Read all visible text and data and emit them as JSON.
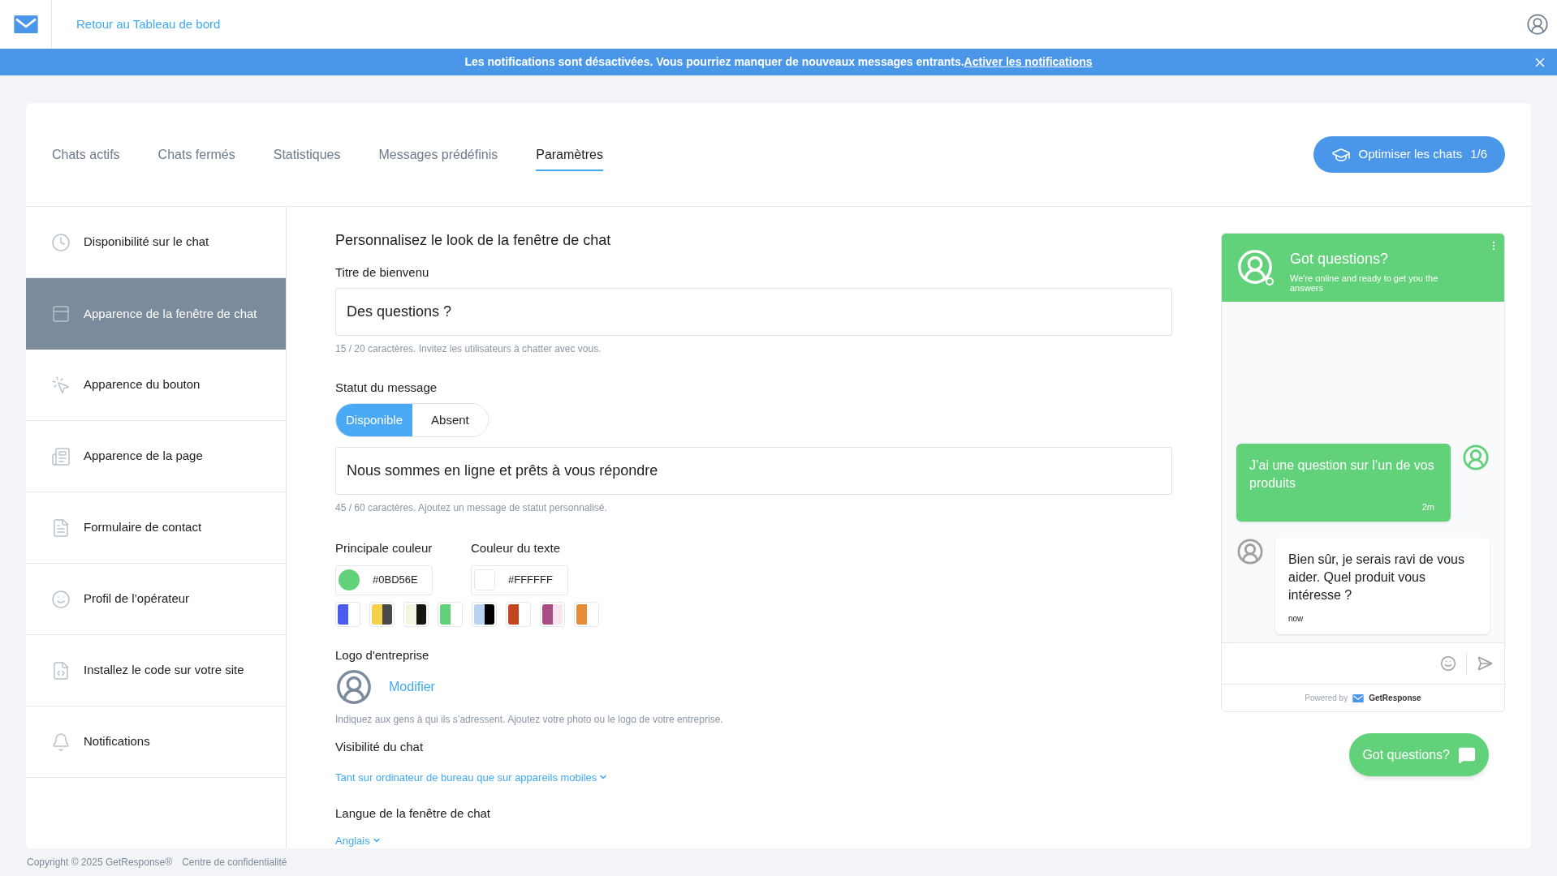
{
  "topbar": {
    "back_link": "Retour au Tableau de bord"
  },
  "banner": {
    "text": "Les notifications sont désactivées. Vous pourriez manquer de nouveaux messages entrants.",
    "link": "Activer les notifications"
  },
  "tabs": [
    {
      "label": "Chats actifs",
      "selected": false
    },
    {
      "label": "Chats fermés",
      "selected": false
    },
    {
      "label": "Statistiques",
      "selected": false
    },
    {
      "label": "Messages prédéfinis",
      "selected": false
    },
    {
      "label": "Paramètres",
      "selected": true
    }
  ],
  "optimize_button": {
    "label": "Optimiser les chats",
    "count": "1/6"
  },
  "sidebar": {
    "items": [
      {
        "label": "Disponibilité sur le chat",
        "kind": "clock",
        "selected": false
      },
      {
        "label": "Apparence de la fenêtre de chat",
        "kind": "window",
        "selected": true
      },
      {
        "label": "Apparence du bouton",
        "kind": "button",
        "selected": false
      },
      {
        "label": "Apparence de la page",
        "kind": "page",
        "selected": false
      },
      {
        "label": "Formulaire de contact",
        "kind": "form",
        "selected": false
      },
      {
        "label": "Profil de l’opérateur",
        "kind": "smile",
        "selected": false
      },
      {
        "label": "Installez le code sur votre site",
        "kind": "code",
        "selected": false
      },
      {
        "label": "Notifications",
        "kind": "bell",
        "selected": false
      }
    ]
  },
  "form": {
    "heading": "Personnalisez le look de la fenêtre de chat",
    "welcome_title": {
      "label": "Titre de bienvenu",
      "value": "Des questions ?",
      "hint": "15 / 20 caractères. Invitez les utilisateurs à chatter avec vous."
    },
    "status": {
      "label": "Statut du message",
      "options": [
        {
          "label": "Disponible",
          "selected": true
        },
        {
          "label": "Absent",
          "selected": false
        }
      ],
      "value": "Nous sommes en ligne et prêts à vous répondre",
      "hint": "45 / 60 caractères. Ajoutez un message de statut personnalisé."
    },
    "main_color": {
      "label": "Principale couleur",
      "value": "#0BD56E",
      "color": "#62d27a"
    },
    "text_color": {
      "label": "Couleur du texte",
      "value": "#FFFFFF",
      "color": "#ffffff"
    },
    "swatches": [
      {
        "left": {
          "color": "#4a5cf0"
        },
        "right": {
          "color": "#ffffff"
        }
      },
      {
        "left": {
          "color": "#f5d04a"
        },
        "right": {
          "color": "#494949"
        }
      },
      {
        "left": {
          "color": "#f2f6df"
        },
        "right": {
          "color": "#151515"
        }
      },
      {
        "left": {
          "color": "#62d27a"
        },
        "right": {
          "color": "#ffffff"
        }
      },
      {
        "left": {
          "color": "#b7d3ef"
        },
        "right": {
          "color": "#000000"
        }
      },
      {
        "left": {
          "color": "#c4461f"
        },
        "right": {
          "color": "#ffffff"
        }
      },
      {
        "left": {
          "color": "#a84c84"
        },
        "right": {
          "color": "#f9e4f0"
        }
      },
      {
        "left": {
          "color": "#e58c3c"
        },
        "right": {
          "color": "#ffffff"
        }
      }
    ],
    "logo": {
      "label": "Logo d'entreprise",
      "link": "Modifier",
      "hint": "Indiquez aux gens à qui ils s’adressent. Ajoutez votre photo ou le logo de votre entreprise."
    },
    "visibility": {
      "label": "Visibilité du chat",
      "value": "Tant sur ordinateur de bureau que sur appareils mobiles"
    },
    "language": {
      "label": "Langue de la fenêtre de chat",
      "value": "Anglais"
    }
  },
  "preview": {
    "title": "Got questions?",
    "subtitle": "We're online and ready to get you the answers",
    "messages": [
      {
        "kind": "visitor",
        "text": "J’ai une question sur l’un de vos produits",
        "time": "2m"
      },
      {
        "kind": "operator",
        "text": "Bien sûr, je serais ravi de vous aider. Quel produit vous intéresse ?",
        "time": "now"
      }
    ],
    "powered_by": "Powered by",
    "brand": "GetResponse",
    "launcher": "Got questions?"
  },
  "footer": {
    "copyright": "Copyright © 2025 GetResponse®",
    "privacy": "Centre de confidentialité"
  }
}
